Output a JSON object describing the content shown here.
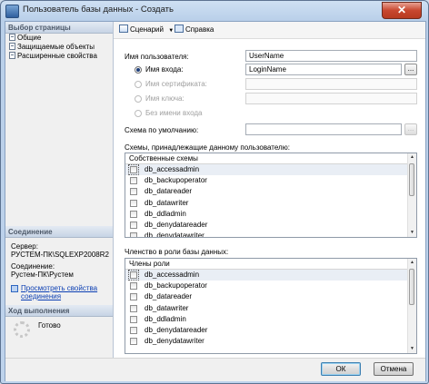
{
  "window": {
    "title": "Пользователь базы данных - Создать",
    "close_glyph": "✕"
  },
  "left": {
    "pages_header": "Выбор страницы",
    "pages": [
      {
        "label": "Общие",
        "icon": "page-icon"
      },
      {
        "label": "Защищаемые объекты",
        "icon": "page-icon"
      },
      {
        "label": "Расширенные свойства",
        "icon": "page-icon"
      }
    ],
    "connection_header": "Соединение",
    "server_label": "Сервер:",
    "server_value": "РУСТЕМ-ПК\\SQLEXP2008R2",
    "connection_label": "Соединение:",
    "connection_value": "Рустем-ПК\\Рустем",
    "view_props_link_line1": "Просмотреть свойства",
    "view_props_link_line2": "соединения",
    "progress_header": "Ход выполнения",
    "progress_status": "Готово"
  },
  "toolbar": {
    "script_label": "Сценарий",
    "script_arrow": "▼",
    "help_label": "Справка"
  },
  "form": {
    "user_name_label": "Имя пользователя:",
    "user_name_value": "UserName",
    "login_name_label": "Имя входа:",
    "login_name_value": "LoginName",
    "cert_name_label": "Имя сертификата:",
    "key_name_label": "Имя ключа:",
    "no_login_label": "Без имени входа",
    "default_schema_label": "Схема по умолчанию:",
    "ellipsis": "...",
    "owned_schemas_label": "Схемы, принадлежащие данному пользователю:",
    "owned_schemas_header": "Собственные схемы",
    "owned_schemas": [
      "db_accessadmin",
      "db_backupoperator",
      "db_datareader",
      "db_datawriter",
      "db_ddladmin",
      "db_denydatareader",
      "db_denydatawriter"
    ],
    "role_membership_label": "Членство в роли базы данных:",
    "roles_header": "Члены роли",
    "roles": [
      "db_accessadmin",
      "db_backupoperator",
      "db_datareader",
      "db_datawriter",
      "db_ddladmin",
      "db_denydatareader",
      "db_denydatawriter"
    ]
  },
  "footer": {
    "ok_label": "ОК",
    "cancel_label": "Отмена"
  }
}
